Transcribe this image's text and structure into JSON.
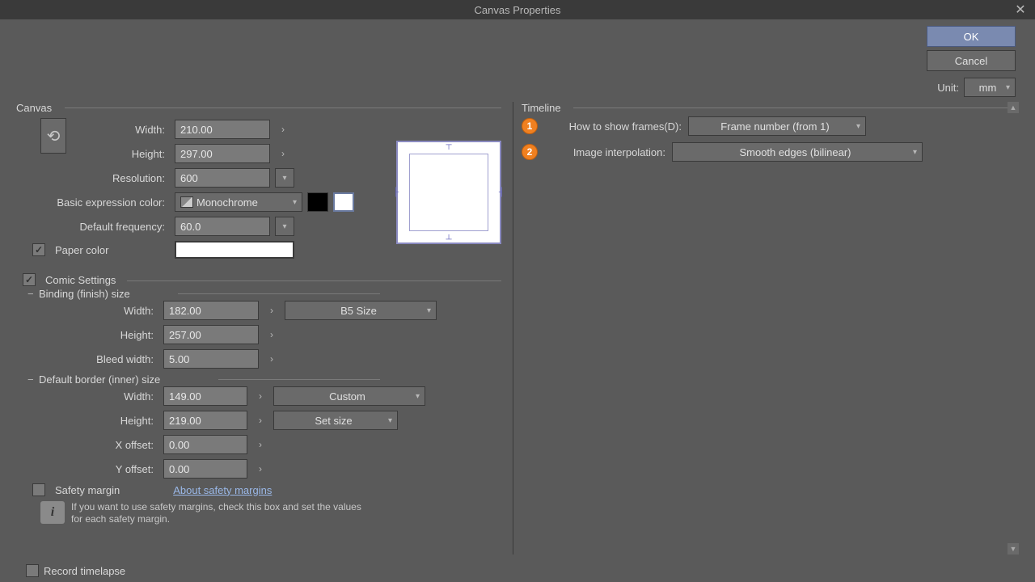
{
  "title": "Canvas Properties",
  "buttons": {
    "ok": "OK",
    "cancel": "Cancel"
  },
  "unit": {
    "label": "Unit:",
    "value": "mm"
  },
  "canvas": {
    "legend": "Canvas",
    "width_label": "Width:",
    "width": "210.00",
    "height_label": "Height:",
    "height": "297.00",
    "resolution_label": "Resolution:",
    "resolution": "600",
    "basic_expr_label": "Basic expression color:",
    "basic_expr_value": "Monochrome",
    "default_freq_label": "Default frequency:",
    "default_freq": "60.0",
    "paper_color_label": "Paper color"
  },
  "comic": {
    "legend": "Comic Settings",
    "binding_legend": "Binding (finish) size",
    "binding_width_label": "Width:",
    "binding_width": "182.00",
    "binding_height_label": "Height:",
    "binding_height": "257.00",
    "binding_preset": "B5 Size",
    "bleed_label": "Bleed width:",
    "bleed": "5.00",
    "border_legend": "Default border (inner) size",
    "border_width_label": "Width:",
    "border_width": "149.00",
    "border_height_label": "Height:",
    "border_height": "219.00",
    "border_preset": "Custom",
    "border_setsize": "Set size",
    "xoffset_label": "X offset:",
    "xoffset": "0.00",
    "yoffset_label": "Y offset:",
    "yoffset": "0.00",
    "safety_margin_label": "Safety margin",
    "safety_link": "About safety margins",
    "safety_info": "If you want to use safety margins, check this box and set the values for each safety margin."
  },
  "timeline": {
    "legend": "Timeline",
    "frames_label": "How to show frames(D):",
    "frames_value": "Frame number (from 1)",
    "interp_label": "Image interpolation:",
    "interp_value": "Smooth edges (bilinear)",
    "badge1": "1",
    "badge2": "2"
  },
  "record_timelapse": "Record timelapse"
}
